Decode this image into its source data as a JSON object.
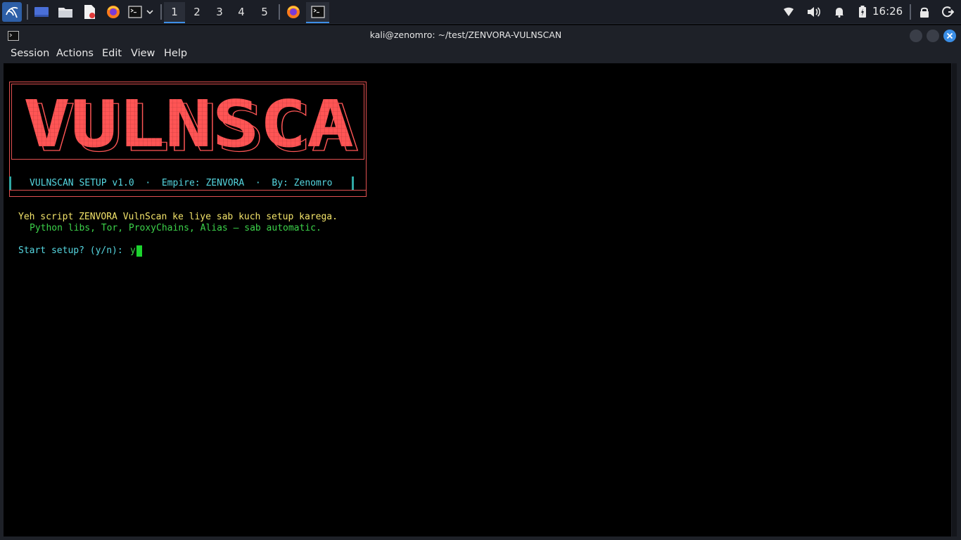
{
  "taskbar": {
    "workspaces": [
      "1",
      "2",
      "3",
      "4",
      "5"
    ],
    "active_workspace": "1",
    "clock": "16:26",
    "accent_color": "#3d8ee6"
  },
  "window": {
    "title": "kali@zenomro: ~/test/ZENVORA-VULNSCAN",
    "menu": [
      "Session",
      "Actions",
      "Edit",
      "View",
      "Help"
    ]
  },
  "terminal": {
    "logo_text": "VULNSCA",
    "banner_line": "VULNSCAN SETUP v1.0  ·  Empire: ZENVORA  ·  By: Zenomro",
    "line1": "Yeh script ZENVORA VulnScan ke liye sab kuch setup karega.",
    "line2": "Python libs, Tor, ProxyChains, Alias — sab automatic.",
    "prompt": "Start setup? (y/n): ",
    "answer": "y",
    "colors": {
      "logo": "#ff5555",
      "cyan": "#55d6e0",
      "yellow": "#f2e36a",
      "green": "#3cd24a"
    }
  }
}
